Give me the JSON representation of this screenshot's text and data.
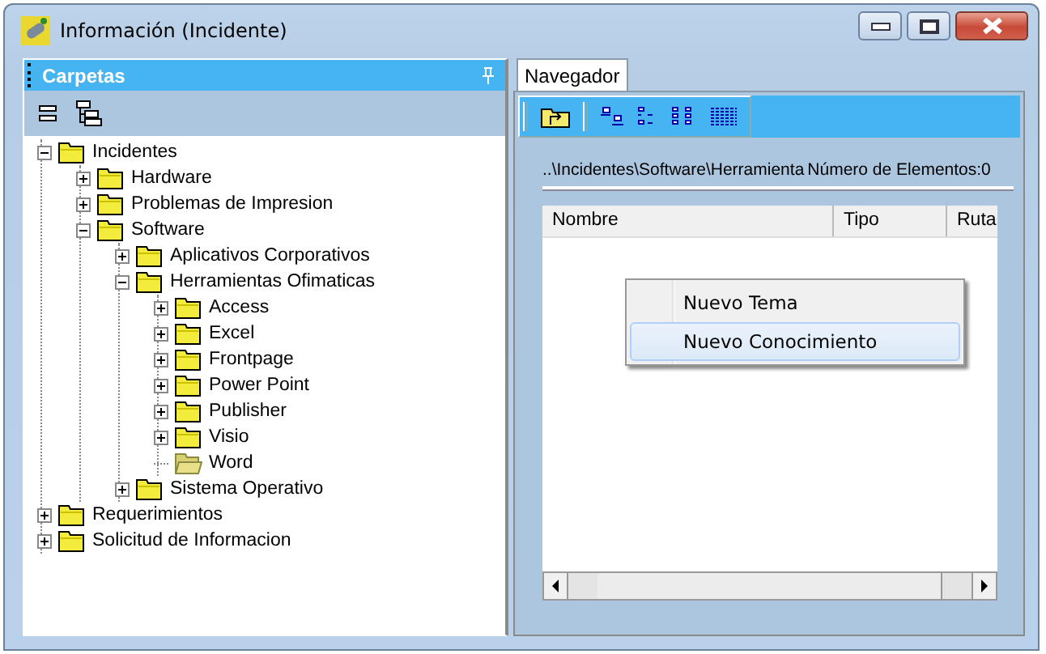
{
  "window": {
    "title": "Información (Incidente)"
  },
  "folders_pane": {
    "title": "Carpetas",
    "tree": [
      {
        "label": "Incidentes",
        "kind": "branch",
        "expanded": true,
        "children": [
          {
            "label": "Hardware",
            "kind": "branch",
            "expanded": false
          },
          {
            "label": "Problemas de Impresion",
            "kind": "branch",
            "expanded": false
          },
          {
            "label": "Software",
            "kind": "branch",
            "expanded": true,
            "children": [
              {
                "label": "Aplicativos Corporativos",
                "kind": "branch",
                "expanded": false
              },
              {
                "label": "Herramientas Ofimaticas",
                "kind": "branch",
                "expanded": true,
                "children": [
                  {
                    "label": "Access",
                    "kind": "branch",
                    "expanded": false
                  },
                  {
                    "label": "Excel",
                    "kind": "branch",
                    "expanded": false
                  },
                  {
                    "label": "Frontpage",
                    "kind": "branch",
                    "expanded": false
                  },
                  {
                    "label": "Power Point",
                    "kind": "branch",
                    "expanded": false
                  },
                  {
                    "label": "Publisher",
                    "kind": "branch",
                    "expanded": false
                  },
                  {
                    "label": "Visio",
                    "kind": "branch",
                    "expanded": false
                  },
                  {
                    "label": "Word",
                    "kind": "leaf"
                  }
                ]
              },
              {
                "label": "Sistema Operativo",
                "kind": "branch",
                "expanded": false
              }
            ]
          }
        ]
      },
      {
        "label": "Requerimientos",
        "kind": "branch",
        "expanded": false
      },
      {
        "label": "Solicitud de Informacion",
        "kind": "branch",
        "expanded": false
      }
    ]
  },
  "tabs": [
    {
      "label": "Navegador",
      "selected": true
    }
  ],
  "navigator": {
    "path": "..\\Incidentes\\Software\\Herramienta",
    "count": "Número de Elementos:0",
    "table": {
      "columns": [
        "Nombre",
        "Tipo",
        "Ruta"
      ]
    }
  },
  "context_menu": {
    "items": [
      {
        "label": "Nuevo Tema",
        "selected": false
      },
      {
        "label": "Nuevo Conocimiento",
        "selected": true
      }
    ]
  }
}
